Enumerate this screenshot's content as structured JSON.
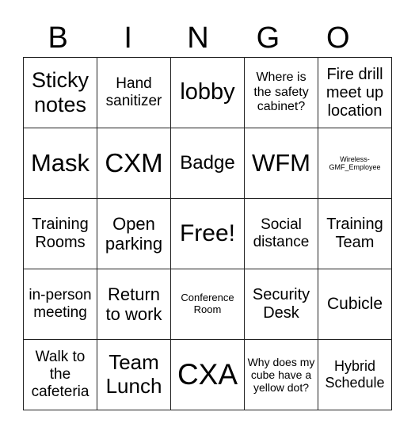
{
  "header": [
    "B",
    "I",
    "N",
    "G",
    "O"
  ],
  "rows": [
    [
      {
        "text": "Sticky notes",
        "size": 27
      },
      {
        "text": "Hand sanitizer",
        "size": 19
      },
      {
        "text": "lobby",
        "size": 29
      },
      {
        "text": "Where is the safety cabinet?",
        "size": 16
      },
      {
        "text": "Fire drill meet up location",
        "size": 20
      }
    ],
    [
      {
        "text": "Mask",
        "size": 31
      },
      {
        "text": "CXM",
        "size": 33
      },
      {
        "text": "Badge",
        "size": 24
      },
      {
        "text": "WFM",
        "size": 31
      },
      {
        "text": "Wireless-GMF_Employee",
        "size": 9
      }
    ],
    [
      {
        "text": "Training Rooms",
        "size": 20
      },
      {
        "text": "Open parking",
        "size": 22
      },
      {
        "text": "Free!",
        "size": 30
      },
      {
        "text": "Social distance",
        "size": 19
      },
      {
        "text": "Training Team",
        "size": 20
      }
    ],
    [
      {
        "text": "in-person meeting",
        "size": 19
      },
      {
        "text": "Return to work",
        "size": 22
      },
      {
        "text": "Conference Room",
        "size": 13
      },
      {
        "text": "Security Desk",
        "size": 20
      },
      {
        "text": "Cubicle",
        "size": 21
      }
    ],
    [
      {
        "text": "Walk to the cafeteria",
        "size": 19
      },
      {
        "text": "Team Lunch",
        "size": 26
      },
      {
        "text": "CXA",
        "size": 37
      },
      {
        "text": "Why does my cube have a yellow dot?",
        "size": 14
      },
      {
        "text": "Hybrid Schedule",
        "size": 18
      }
    ]
  ]
}
